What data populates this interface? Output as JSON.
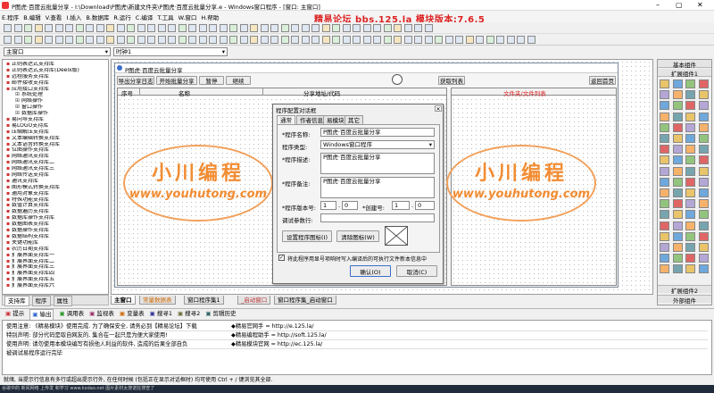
{
  "title_bar": {
    "title": "P图虎·百度云批量分享 - I:\\Download\\P图虎\\新建文件夹\\P图虎·百度云批量分享.e - Windows窗口程序 - [窗口: 主窗口]",
    "min": "–",
    "max": "▢",
    "close": "✕"
  },
  "menu": [
    "E.程序",
    "B.编辑",
    "V.查看",
    "I.插入",
    "B.数据库",
    "R.运行",
    "C.编译",
    "T.工具",
    "W.窗口",
    "H.帮助"
  ],
  "banner": "精易论坛 bbs.125.la 模块版本:7.6.5",
  "combo_left": "主窗口",
  "combo_right": "时钟1",
  "tree": [
    "正则表达式支持库",
    "正则表达式支持库(Deelx版)",
    "远程服务支持库",
    "邮件接收支持库",
    "应用接口支持库",
    "系统处理",
    "网络操作",
    "窗口操作",
    "数据库操作",
    "易向导支持库",
    "易LOGO支持库",
    "压缩解压支持库",
    "文本编辑转换支持库",
    "文本语音转换支持库",
    "位图操作支持库",
    "网络通讯支持库",
    "网络通讯支持库二",
    "网络通讯支持库三",
    "网络传送支持库",
    "通讯支持库",
    "图形模式转换支持库",
    "通用对象支持库",
    "特殊功能支持库",
    "数值计算支持库",
    "数据遍历支持库",
    "数据库操作支持库",
    "数据图表支持库",
    "数据操作支持库",
    "数据结构支持库",
    "关键功能库",
    "农历日期支持库",
    "扩展界面支持库一",
    "扩展界面支持库二",
    "扩展界面支持库三",
    "扩展界面支持库四",
    "扩展界面支持库五",
    "扩展界面支持库六"
  ],
  "left_tabs": [
    "支持库",
    "程序",
    "属性"
  ],
  "form": {
    "title": "P图虎·百度云批量分享",
    "buttons": [
      "导出分享日志",
      "开始批量分享",
      "暂停",
      "继续"
    ],
    "right_buttons": [
      "获取列表",
      "返回首页"
    ],
    "cols": [
      "序号",
      "名称",
      "分享地址/代码"
    ],
    "right_header": "文件夹/文件列表"
  },
  "dialog": {
    "title": "程序配置对话框",
    "tabs": [
      "通常",
      "作者信息",
      "易模块",
      "其它"
    ],
    "name_label": "*程序名称:",
    "name_value": "P图虎·百度云批量分享",
    "type_label": "程序类型:",
    "type_value": "Windows窗口程序",
    "desc_label": "*程序描述:",
    "desc_value": "P图虎·百度云批量分享",
    "remark_label": "*程序备注:",
    "remark_value": "P图虎·百度云批量分享",
    "ver_label": "*程序版本号:",
    "ver1": "1",
    "ver2": "0",
    "build_label": "*创建号:",
    "build1": "1",
    "build2": "0",
    "param_label": "调试参数行:",
    "set_icon": "设置程序图标(I)",
    "clear_icon": "清除图标(W)",
    "checkbox": "将此程序用显号项响时写入编译后的可执行文件新本信息中",
    "ok": "确认(O)",
    "cancel": "取消(C)"
  },
  "watermark": {
    "line1": "小川编程",
    "line2": "www.youhutong.com"
  },
  "bottom_tabs": [
    "主窗口",
    "常量数据表",
    "窗口程序集1",
    "_启动窗口",
    "窗口程序集_启动窗口"
  ],
  "right_panel": {
    "title": "基本组件",
    "sub": "扩展组件1",
    "sub2": "扩展组件2",
    "sub3": "外部组件"
  },
  "out_tabs": [
    "提示",
    "输出",
    "调用表",
    "监视表",
    "变量表",
    "搜寻1",
    "搜寻2",
    "剪辑历史"
  ],
  "out_lines": [
    {
      "l": "使用注意: 《精易模块》使用完成. 为了确保安全, 请务必到【精易论坛】下载",
      "r": "◆精易官网手     =  http://e.125.la/"
    },
    {
      "l": "特别声明: 部分代码是取自网友的, 集合在一起只是为便大家使用!",
      "r": "◆精易编程助手     =  http://soft.125.la/"
    },
    {
      "l": "使用声明: 请勿使用本模块编写有损他人利益的软件, 造成的后果全部自负",
      "r": "◆精易模块官网     =  http://ec.125.la/"
    },
    {
      "l": "被调试易程序运行完毕",
      "r": ""
    }
  ],
  "status": "就绪, 当提示行信息有多行或超出提示行外, 在任何时候 (包括正在显示对话框时) 均可使用 Ctrl + / 键浏览其全部.",
  "taskbar": "谷歌中的 新闻网络 上传发 和学习 www.kxdao.net 图片素材太搜诺狂搜查了"
}
